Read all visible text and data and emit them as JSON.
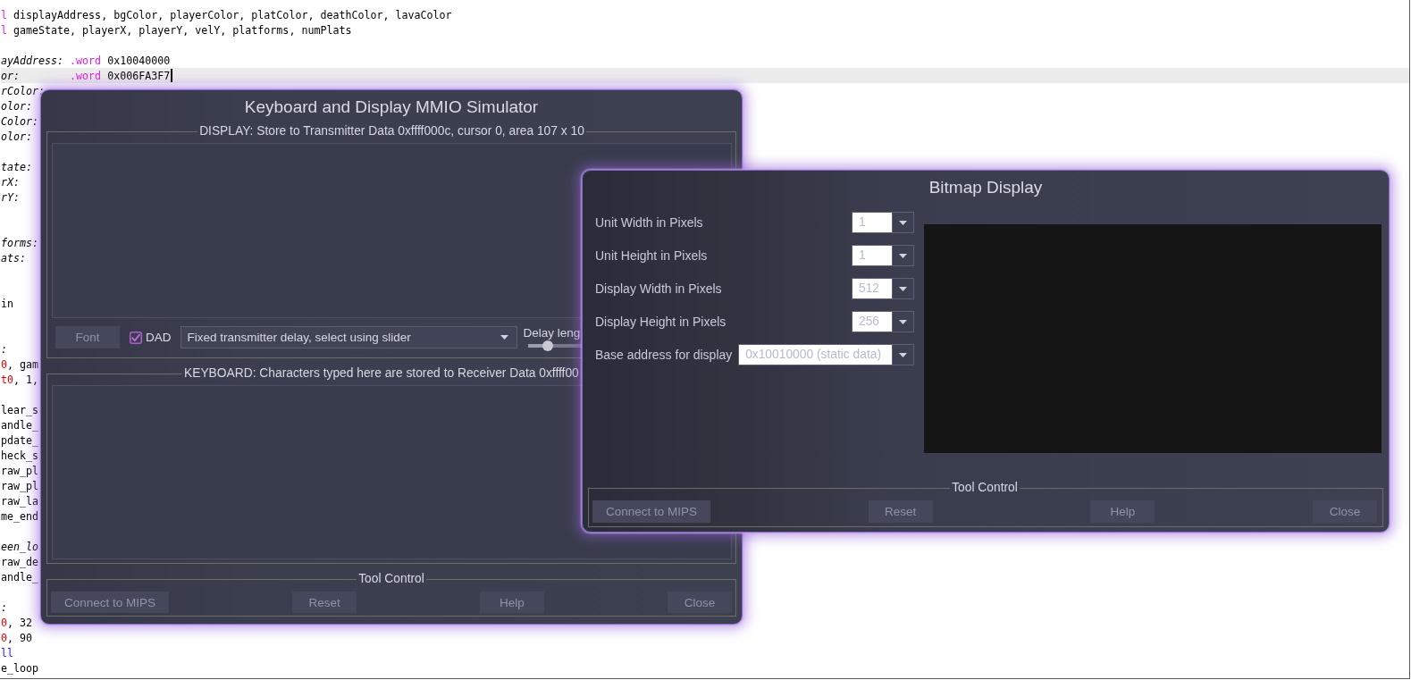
{
  "editor": {
    "lines": [
      {
        "current": false,
        "segments": [
          {
            "kind": "directive",
            "text": "l"
          },
          {
            "kind": "plain",
            "text": "displayAddress, bgColor, playerColor, platColor, deathColor, lavaColor"
          }
        ]
      },
      {
        "current": false,
        "segments": [
          {
            "kind": "directive",
            "text": "l"
          },
          {
            "kind": "plain",
            "text": "gameState, playerX, playerY, velY, platforms, numPlats"
          }
        ]
      },
      {
        "current": false
      },
      {
        "current": false,
        "segments": [
          {
            "kind": "label",
            "text": "ayAddress:"
          },
          {
            "kind": "directive",
            "text": ".word"
          },
          {
            "kind": "plain",
            "text": "0x10040000"
          }
        ]
      },
      {
        "current": true,
        "segments": [
          {
            "kind": "label",
            "text": "or:"
          },
          {
            "kind": "directive",
            "text": ".word"
          },
          {
            "kind": "plain",
            "text": "0x006FA3F7"
          }
        ]
      },
      {
        "current": false,
        "segments": [
          {
            "kind": "label",
            "text": "rColor:"
          }
        ]
      },
      {
        "current": false,
        "segments": [
          {
            "kind": "label",
            "text": "olor:"
          }
        ]
      },
      {
        "current": false,
        "segments": [
          {
            "kind": "label",
            "text": "Color:"
          }
        ]
      },
      {
        "current": false,
        "segments": [
          {
            "kind": "label",
            "text": "olor:"
          }
        ]
      },
      {
        "current": false
      },
      {
        "current": false,
        "segments": [
          {
            "kind": "label",
            "text": "tate:"
          }
        ]
      },
      {
        "current": false,
        "segments": [
          {
            "kind": "label",
            "text": "rX:"
          }
        ]
      },
      {
        "current": false,
        "segments": [
          {
            "kind": "label",
            "text": "rY:"
          }
        ]
      },
      {
        "current": false
      },
      {
        "current": false
      },
      {
        "current": false,
        "segments": [
          {
            "kind": "label",
            "text": "forms:"
          }
        ]
      },
      {
        "current": false,
        "segments": [
          {
            "kind": "label",
            "text": "ats:"
          }
        ]
      },
      {
        "current": false
      },
      {
        "current": false
      },
      {
        "current": false,
        "segments": [
          {
            "kind": "plain",
            "text": "in"
          }
        ]
      },
      {
        "current": false
      },
      {
        "current": false
      },
      {
        "current": false,
        "segments": [
          {
            "kind": "label",
            "text": ":"
          }
        ]
      },
      {
        "current": false,
        "segments": [
          {
            "kind": "register",
            "text": "0"
          },
          {
            "kind": "plain",
            "text": ", gam"
          }
        ]
      },
      {
        "current": false,
        "segments": [
          {
            "kind": "register",
            "text": "t0"
          },
          {
            "kind": "plain",
            "text": ", 1,"
          }
        ]
      },
      {
        "current": false
      },
      {
        "current": false,
        "segments": [
          {
            "kind": "plain",
            "text": "lear_s"
          }
        ]
      },
      {
        "current": false,
        "segments": [
          {
            "kind": "plain",
            "text": "andle_"
          }
        ]
      },
      {
        "current": false,
        "segments": [
          {
            "kind": "plain",
            "text": "pdate_"
          }
        ]
      },
      {
        "current": false,
        "segments": [
          {
            "kind": "plain",
            "text": "heck_s"
          }
        ]
      },
      {
        "current": false,
        "segments": [
          {
            "kind": "plain",
            "text": "raw_pl"
          }
        ]
      },
      {
        "current": false,
        "segments": [
          {
            "kind": "plain",
            "text": "raw_pl"
          }
        ]
      },
      {
        "current": false,
        "segments": [
          {
            "kind": "plain",
            "text": "raw_la"
          }
        ]
      },
      {
        "current": false,
        "segments": [
          {
            "kind": "plain",
            "text": "me_end"
          }
        ]
      },
      {
        "current": false
      },
      {
        "current": false,
        "segments": [
          {
            "kind": "label",
            "text": "een_lo"
          }
        ]
      },
      {
        "current": false,
        "segments": [
          {
            "kind": "plain",
            "text": "raw_de"
          }
        ]
      },
      {
        "current": false,
        "segments": [
          {
            "kind": "plain",
            "text": "andle_"
          }
        ]
      },
      {
        "current": false
      },
      {
        "current": false,
        "segments": [
          {
            "kind": "label",
            "text": ":"
          }
        ]
      },
      {
        "current": false,
        "segments": [
          {
            "kind": "register",
            "text": "0"
          },
          {
            "kind": "plain",
            "text": ", 32"
          }
        ]
      },
      {
        "current": false,
        "segments": [
          {
            "kind": "register",
            "text": "0"
          },
          {
            "kind": "plain",
            "text": ", 90"
          }
        ]
      },
      {
        "current": false,
        "segments": [
          {
            "kind": "keyword",
            "text": "ll"
          }
        ]
      },
      {
        "current": false,
        "segments": [
          {
            "kind": "plain",
            "text": "e_loop"
          }
        ]
      }
    ]
  },
  "keyboard_display_window": {
    "title": "Keyboard and Display MMIO Simulator",
    "display_group": {
      "title": "DISPLAY: Store to Transmitter Data 0xffff000c, cursor 0, area 107 x 10",
      "font_button": "Font",
      "dad_checkbox": {
        "label": "DAD",
        "checked": true
      },
      "delay_mode": "Fixed transmitter delay, select using slider",
      "delay_label": "Delay leng",
      "delay_slider": {
        "level": 0.1
      }
    },
    "keyboard_group": {
      "title": "KEYBOARD: Characters typed here are stored to Receiver Data 0xffff00"
    },
    "tool_control": {
      "title": "Tool Control",
      "buttons": [
        "Connect to MIPS",
        "Reset",
        "Help",
        "Close"
      ]
    }
  },
  "bitmap_display_window": {
    "title": "Bitmap Display",
    "settings": [
      {
        "label": "Unit Width in Pixels",
        "value": "1"
      },
      {
        "label": "Unit Height in Pixels",
        "value": "1"
      },
      {
        "label": "Display Width in Pixels",
        "value": "512"
      },
      {
        "label": "Display Height in Pixels",
        "value": "256"
      },
      {
        "label": "Base address for display",
        "value": "0x10010000 (static data)"
      }
    ],
    "tool_control": {
      "title": "Tool Control",
      "buttons": [
        "Connect to MIPS",
        "Reset",
        "Help",
        "Close"
      ]
    }
  }
}
